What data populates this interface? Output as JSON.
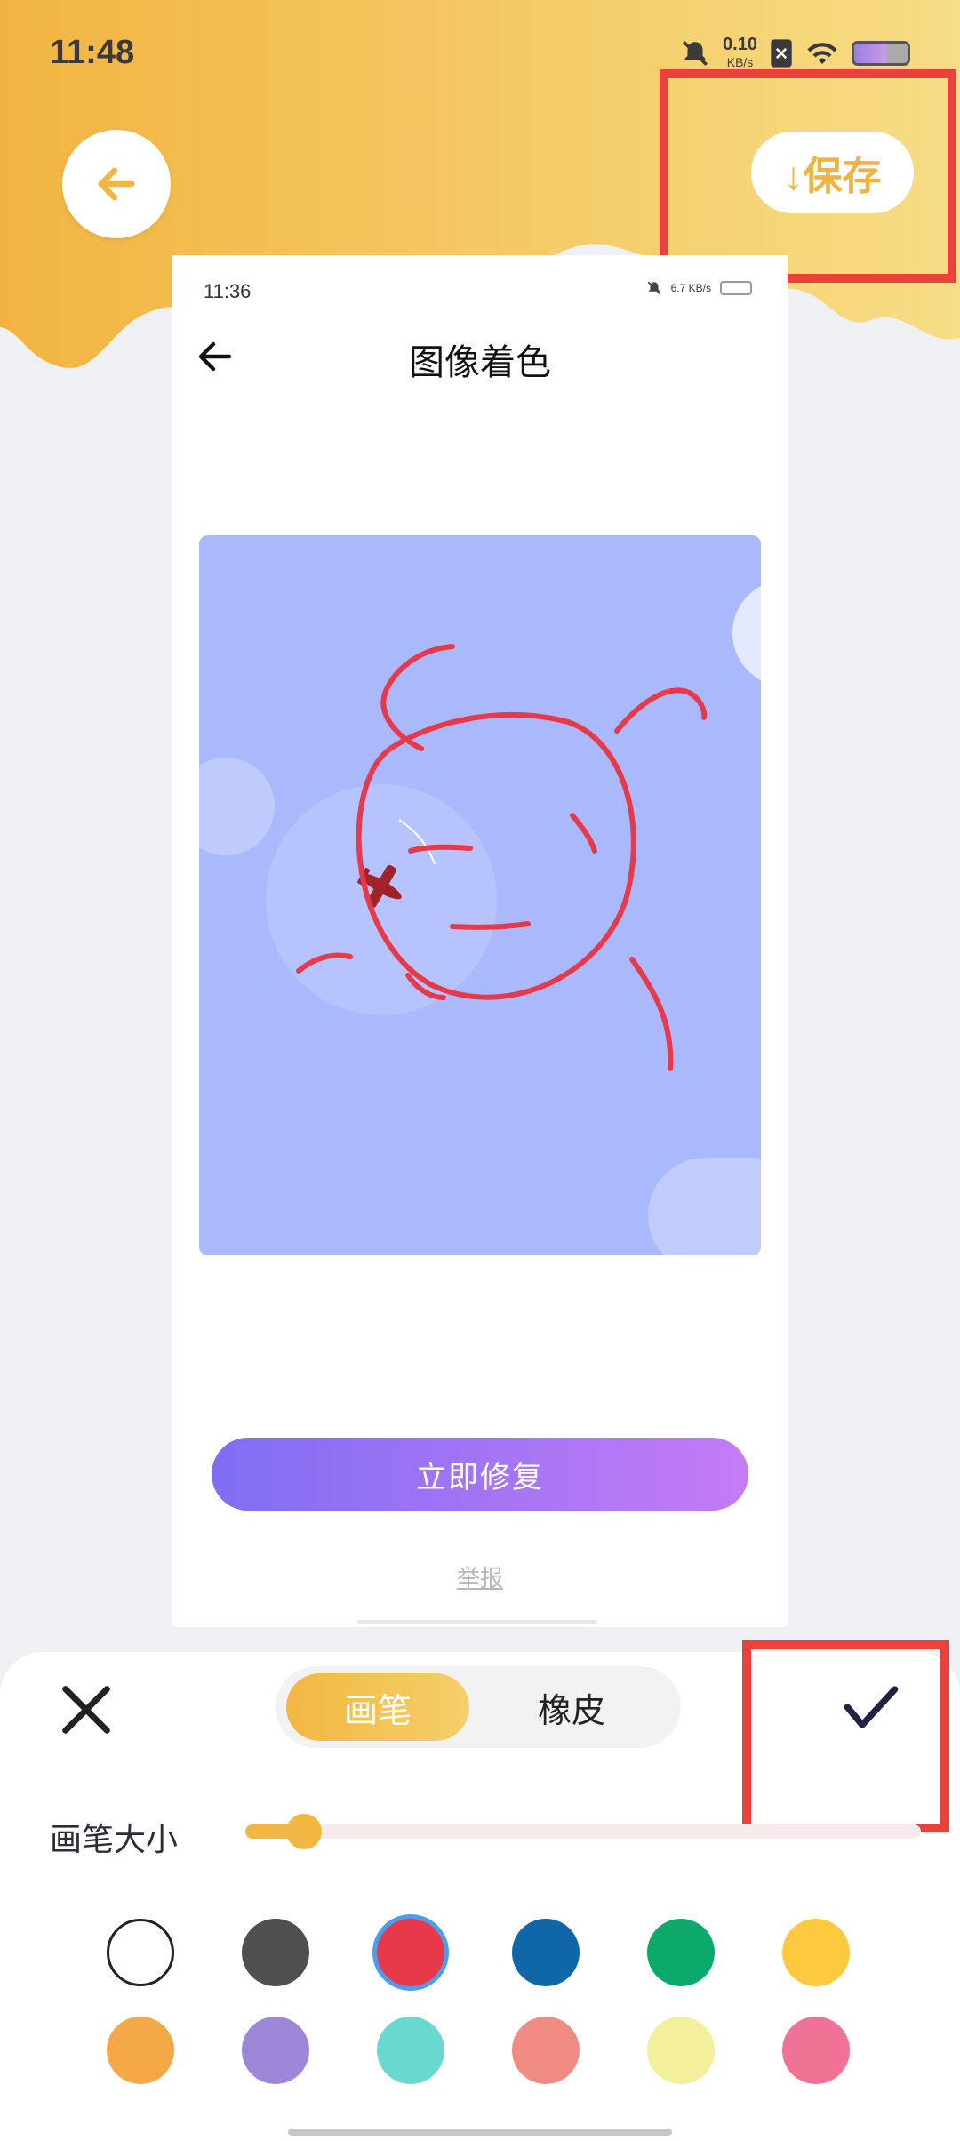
{
  "status_bar": {
    "time": "11:48",
    "net_speed": "0.10",
    "net_unit": "KB/s"
  },
  "header": {
    "save_label": "↓保存"
  },
  "embedded": {
    "time": "11:36",
    "net_speed": "6.7",
    "net_unit": "KB/s",
    "title": "图像着色",
    "fix_button": "立即修复",
    "report_link": "举报"
  },
  "panel": {
    "pen_label": "画笔",
    "eraser_label": "橡皮",
    "brush_size_label": "画笔大小",
    "brush_size_fraction": 0.06,
    "colors": [
      "#ffffff",
      "#4f4f4f",
      "#e8394b",
      "#0f67a8",
      "#0da96b",
      "#fdc93f",
      "#f4a848",
      "#9b86d8",
      "#69d9cf",
      "#f08b84",
      "#f3ef9c",
      "#f07294"
    ],
    "selected_color_index": 2
  },
  "colors": {
    "accent": "#f2b742",
    "highlight": "#e9423b",
    "fix_gradient_start": "#7f6ef2",
    "fix_gradient_end": "#c57bf6"
  }
}
